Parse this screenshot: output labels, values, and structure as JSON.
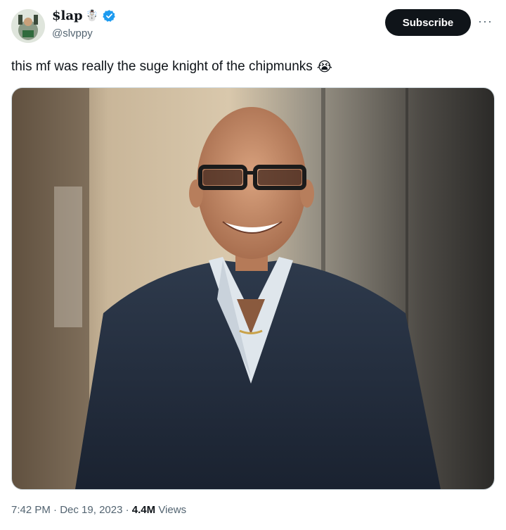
{
  "author": {
    "display_name": "$lap",
    "handle": "@slvppy",
    "badge_emoji": "☃️",
    "avatar_icon": "avatar",
    "verified_icon": "verified-badge-icon",
    "verified_color": "#1d9bf0"
  },
  "actions": {
    "subscribe_label": "Subscribe",
    "more_label": "···"
  },
  "tweet": {
    "text": "this mf was really the suge knight of the chipmunks",
    "emoji": "😭"
  },
  "media": {
    "alt_icon": "photo"
  },
  "meta": {
    "time": "7:42 PM",
    "sep1": " · ",
    "date": "Dec 19, 2023",
    "sep2": " · ",
    "views_count": "4.4M",
    "views_label": " Views"
  }
}
